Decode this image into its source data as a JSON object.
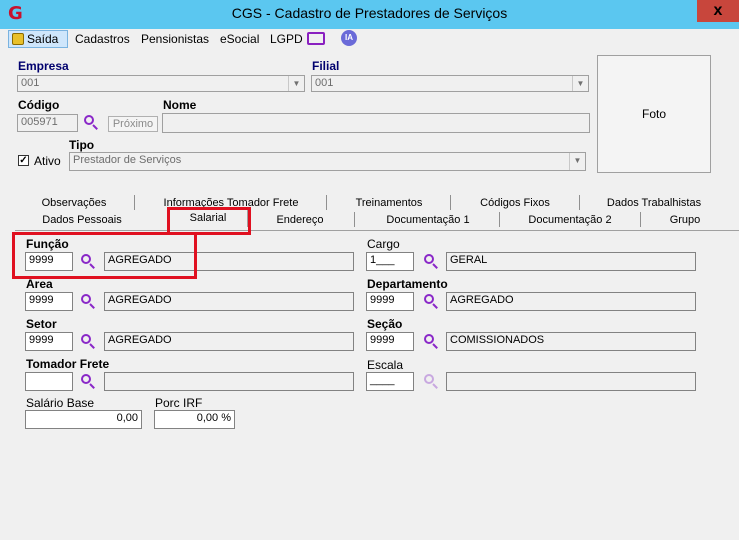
{
  "window": {
    "title": "CGS - Cadastro de Prestadores de Serviços",
    "close_label": "x"
  },
  "menu": {
    "exit": "Saída",
    "items": [
      "Cadastros",
      "Pensionistas",
      "eSocial",
      "LGPD"
    ],
    "ia_label": "IA"
  },
  "header": {
    "empresa_label": "Empresa",
    "empresa_value": "001",
    "filial_label": "Filial",
    "filial_value": "001",
    "codigo_label": "Código",
    "codigo_value": "005971",
    "next_button": "Próximo",
    "nome_label": "Nome",
    "nome_value": "",
    "ativo_label": "Ativo",
    "ativo_checked": true,
    "tipo_label": "Tipo",
    "tipo_value": "Prestador de Serviços",
    "foto_label": "Foto"
  },
  "tabs": {
    "row1": [
      "Observações",
      "Informações Tomador Frete",
      "Treinamentos",
      "Códigos Fixos",
      "Dados Trabalhistas"
    ],
    "row2": [
      "Dados Pessoais",
      "Salarial",
      "Endereço",
      "Documentação 1",
      "Documentação 2",
      "Grupo"
    ],
    "active": "Salarial"
  },
  "salarial": {
    "funcao": {
      "label": "Função",
      "code": "9999",
      "desc": "AGREGADO"
    },
    "cargo": {
      "label": "Cargo",
      "code": "1___",
      "desc": "GERAL"
    },
    "area": {
      "label": "Area",
      "code": "9999",
      "desc": "AGREGADO"
    },
    "departamento": {
      "label": "Departamento",
      "code": "9999",
      "desc": "AGREGADO"
    },
    "setor": {
      "label": "Setor",
      "code": "9999",
      "desc": "AGREGADO"
    },
    "secao": {
      "label": "Seção",
      "code": "9999",
      "desc": "COMISSIONADOS"
    },
    "tomador": {
      "label": "Tomador Frete",
      "code": "",
      "desc": ""
    },
    "escala": {
      "label": "Escala",
      "code": "____",
      "desc": ""
    },
    "salario_base": {
      "label": "Salário Base",
      "value": "0,00"
    },
    "porc_irf": {
      "label": "Porc IRF",
      "value": "0,00 %"
    }
  },
  "colors": {
    "title_bar": "#5bc7f0",
    "highlight": "#e01020",
    "search_icon": "#8a28c8"
  }
}
